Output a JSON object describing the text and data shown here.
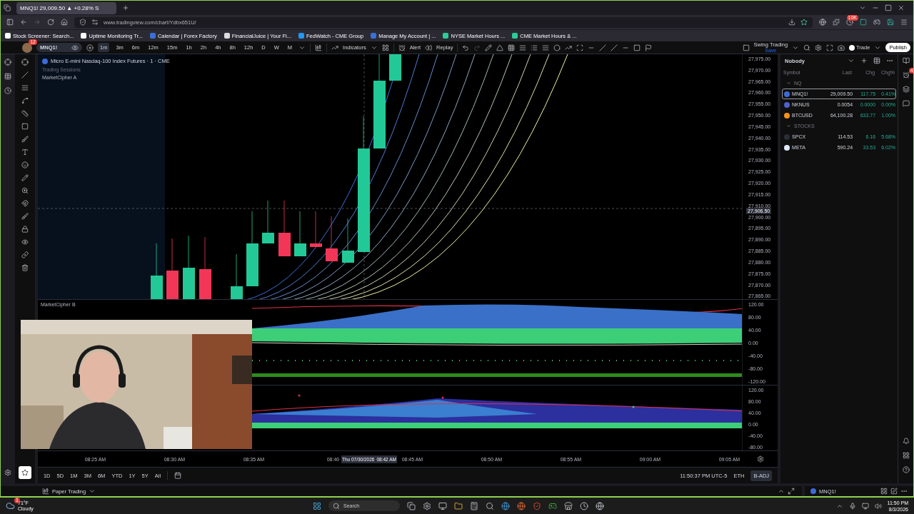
{
  "browser": {
    "tabs": [
      {
        "title": "MNQ1! 29,009.50 ▲ +0.28% S",
        "selected": true
      }
    ],
    "url": "www.tradingview.com/chart/Ydbx651U/",
    "bookmarks": [
      "Stock Screener: Search...",
      "Uptime Monitoring Tr...",
      "Calendar | Forex Factory",
      "FinancialJuice | Your Fi...",
      "FedWatch - CME Group",
      "Manage My Account | ...",
      "NYSE Market Hours ...",
      "CME Market Hours & ..."
    ],
    "extension_badge": "10K"
  },
  "toolbar": {
    "avatar_badge": "12",
    "symbol": "MNQ1!",
    "intervals": [
      {
        "label": "1m",
        "selected": true
      },
      {
        "label": "3m",
        "selected": false
      },
      {
        "label": "6m",
        "selected": false
      },
      {
        "label": "12m",
        "selected": false
      },
      {
        "label": "15m",
        "selected": false
      },
      {
        "label": "1h",
        "selected": false
      },
      {
        "label": "2h",
        "selected": false
      },
      {
        "label": "4h",
        "selected": false
      },
      {
        "label": "8h",
        "selected": false
      },
      {
        "label": "12h",
        "selected": false
      },
      {
        "label": "D",
        "selected": false
      },
      {
        "label": "W",
        "selected": false
      },
      {
        "label": "M",
        "selected": false
      }
    ],
    "indicators": "Indicators",
    "alert": "Alert",
    "replay": "Replay",
    "layout_name": "Swing Trading",
    "layout_save": "Save",
    "trade": "Trade",
    "publish": "Publish"
  },
  "chart": {
    "title": "Micro E-mini Nasdaq-100 Index Futures · 1 · CME",
    "sessions": "Trading Sessions",
    "indicator_a": "MarketCipher A",
    "indicator_b": "MarketCipher B",
    "price_axis": [
      "27,975.00",
      "27,970.00",
      "27,965.00",
      "27,960.00",
      "27,955.00",
      "27,950.00",
      "27,945.00",
      "27,940.00",
      "27,935.00",
      "27,930.00",
      "27,925.00",
      "27,920.00",
      "27,915.00",
      "27,910.00",
      "27,900.00",
      "27,895.00",
      "27,890.00",
      "27,885.00",
      "27,880.00",
      "27,875.00",
      "27,870.00",
      "27,865.00"
    ],
    "current_price": "27,906.50",
    "osc_axis_1": [
      "120.00",
      "80.00",
      "40.00",
      "0.00",
      "-40.00",
      "-80.00",
      "-120.00"
    ],
    "osc_axis_2": [
      "120.00",
      "80.00",
      "40.00",
      "0.00",
      "-40.00",
      "-80.00"
    ],
    "time_axis": [
      "08:25 AM",
      "08:30 AM",
      "08:35 AM",
      "08:40",
      "08:45 AM",
      "08:50 AM",
      "08:55 AM",
      "09:00 AM",
      "09:05 AM"
    ],
    "crosshair_date": "Thu 07/30/2026",
    "crosshair_time": "08:42 AM"
  },
  "range_bar": {
    "ranges": [
      "1D",
      "5D",
      "1M",
      "3M",
      "6M",
      "YTD",
      "1Y",
      "5Y",
      "All"
    ],
    "clock": "11:50:37 PM UTC-5",
    "session": "ETH",
    "adjust": "B-ADJ"
  },
  "bottom_panel": {
    "title": "Paper Trading"
  },
  "watchlist": {
    "name": "Nobody",
    "columns": [
      "Symbol",
      "Last",
      "Chg",
      "Chg%"
    ],
    "sections": [
      {
        "title": "NQ",
        "rows": [
          {
            "symbol": "MNQ1!",
            "last": "29,009.50",
            "chg": "117.75",
            "chg_pct": "0.41%",
            "selected": true,
            "color": "#3d6bd6"
          },
          {
            "symbol": "NKNUS",
            "last": "0.0054",
            "chg": "0.0000",
            "chg_pct": "0.00%",
            "selected": false,
            "color": "#4a63c9"
          },
          {
            "symbol": "BTCUSD",
            "last": "64,100.28",
            "chg": "633.77",
            "chg_pct": "1.00%",
            "selected": false,
            "color": "#f7931a"
          }
        ]
      },
      {
        "title": "STOCKS",
        "rows": [
          {
            "symbol": "SPCX",
            "last": "114.53",
            "chg": "6.16",
            "chg_pct": "5.68%",
            "selected": false,
            "color": "#2a2e39"
          },
          {
            "symbol": "META",
            "last": "590.24",
            "chg": "33.53",
            "chg_pct": "6.02%",
            "selected": false,
            "color": "#dfe9ff"
          }
        ]
      }
    ],
    "footer_symbol": "MNQ1!",
    "alerts_badge": "4"
  },
  "taskbar": {
    "weather_badge": "1",
    "temperature": "71°F",
    "weather": "Cloudy",
    "search": "Search",
    "time": "11:50 PM",
    "date": "8/3/2026"
  }
}
